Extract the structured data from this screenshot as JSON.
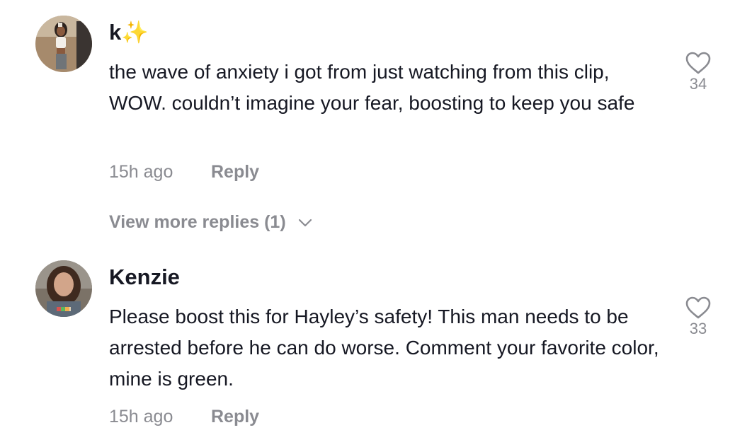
{
  "comments": [
    {
      "username": "k✨",
      "text": "the wave of anxiety i got from just watching from this clip, WOW. couldn’t imagine your fear, boosting to keep you safe",
      "time": "15h ago",
      "reply_label": "Reply",
      "likes": "34",
      "avatar_icon": "user-avatar-photo"
    },
    {
      "username": "Kenzie",
      "text": "Please boost this for Hayley’s safety! This man needs to be arrested before he can do worse. Comment your favorite color, mine is green.",
      "time": "15h ago",
      "reply_label": "Reply",
      "likes": "33",
      "avatar_icon": "user-avatar-photo"
    }
  ],
  "view_more_replies": "View more replies (1)",
  "icons": {
    "like": "heart-outline-icon",
    "expand": "chevron-down-icon"
  },
  "colors": {
    "text_primary": "#161823",
    "text_secondary": "#8a8b91",
    "background": "#ffffff"
  }
}
